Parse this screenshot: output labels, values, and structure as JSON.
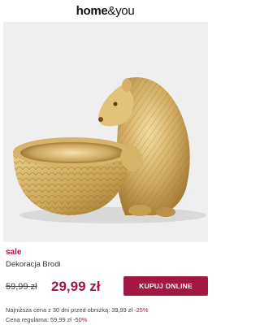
{
  "header": {
    "logo_bold": "home",
    "logo_light": "&you"
  },
  "product": {
    "image_description": "gold hedgehog figurine holding a bowl",
    "sale_label": "sale",
    "name": "Dekoracja Brodi",
    "old_price": "59,99 zł",
    "new_price": "29,99 zł",
    "buy_button_label": "KUPUJ ONLINE",
    "lowest_price_text": "Najniższa cena z 30 dni przed obniżką: 39,99 zł",
    "lowest_price_discount": "-25%",
    "regular_price_text": "Cena regularna: 59,99 zł",
    "regular_price_discount": "-50%"
  },
  "colors": {
    "accent": "#a31842",
    "image_background": "#efefef",
    "gold": "#c9a255"
  }
}
